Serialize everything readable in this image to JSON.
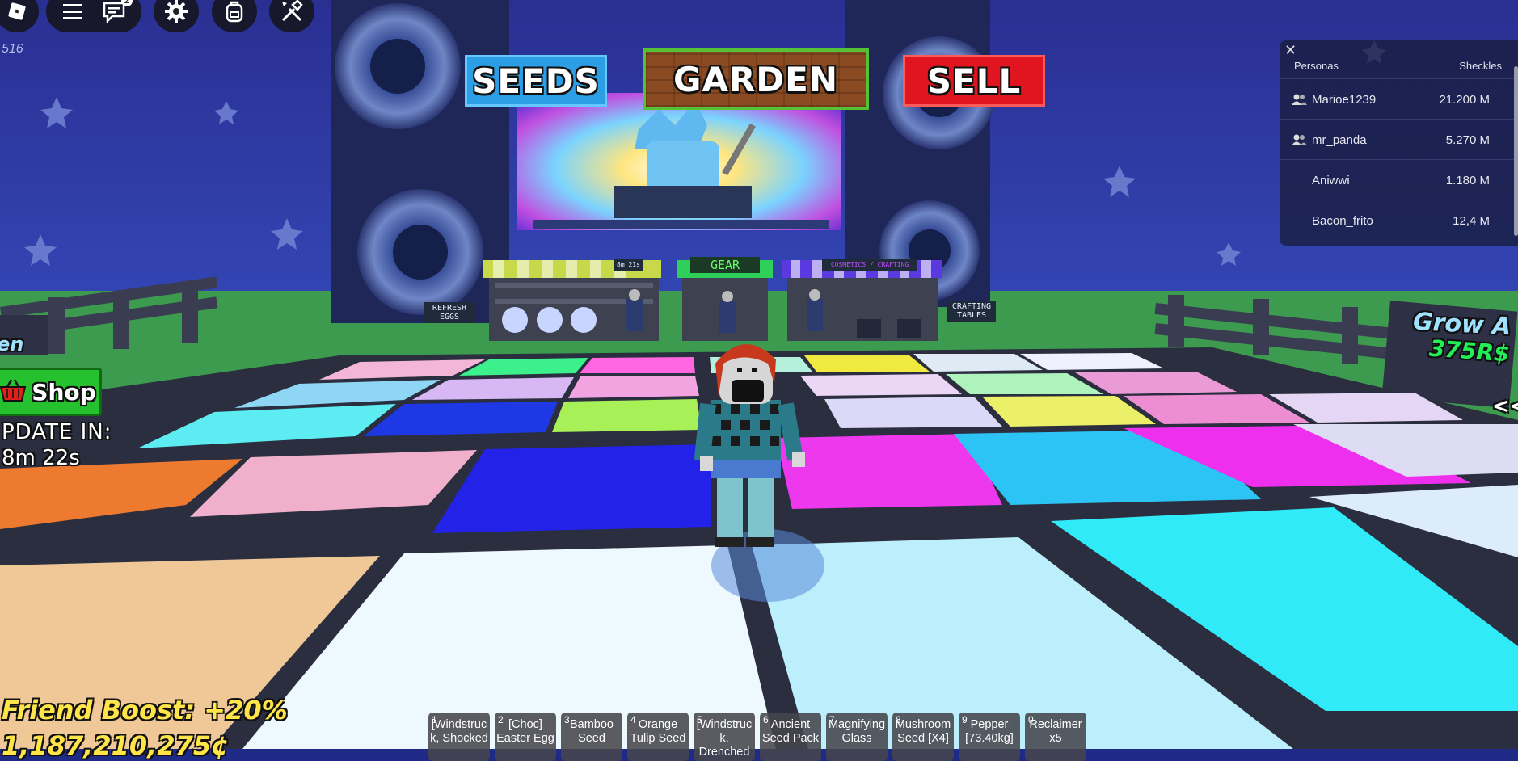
{
  "toolbar": {
    "buttons": [
      {
        "name": "roblox-menu-icon"
      },
      {
        "name": "hamburger-menu-icon"
      },
      {
        "name": "chat-icon",
        "badge": "2"
      },
      {
        "name": "settings-gear-icon"
      },
      {
        "name": "backpack-icon"
      },
      {
        "name": "build-tools-icon"
      }
    ],
    "fps_counter": "516"
  },
  "world_signs": {
    "seeds": "SEEDS",
    "garden": "GARDEN",
    "sell": "SELL",
    "gear": "GEAR",
    "cosmetics": "COSMETICS / CRAFTING",
    "refresh_eggs": "REFRESH EGGS",
    "crafting_tables": "CRAFTING TABLES",
    "stall_timer": "8m 21s",
    "grow_a": "Grow A",
    "grow_price": "375R$",
    "left_sign_fragment": "en"
  },
  "leaderboard": {
    "header_players": "Personas",
    "header_value": "Sheckles",
    "rows": [
      {
        "name": "Marioe1239",
        "value": "21.200 M",
        "friend_icon": true
      },
      {
        "name": "mr_panda",
        "value": "5.270 M",
        "friend_icon": true
      },
      {
        "name": "Aniwwi",
        "value": "1.180 M",
        "friend_icon": false
      },
      {
        "name": "Bacon_frito",
        "value": "12,4 M",
        "friend_icon": false
      }
    ]
  },
  "hud": {
    "shop_label": "Shop",
    "update_label": "PDATE IN:",
    "update_time": "8m 22s",
    "friend_boost": "Friend Boost: +20%",
    "money": "1,187,210,275¢",
    "side_arrow": "<<"
  },
  "hotbar": [
    {
      "key": "1",
      "label": "[Windstruck, Shocked"
    },
    {
      "key": "2",
      "label": "[Choc] Easter Egg"
    },
    {
      "key": "3",
      "label": "Bamboo Seed"
    },
    {
      "key": "4",
      "label": "Orange Tulip Seed"
    },
    {
      "key": "5",
      "label": "[Windstruck, Drenched"
    },
    {
      "key": "6",
      "label": "Ancient Seed Pack"
    },
    {
      "key": "7",
      "label": "Magnifying Glass"
    },
    {
      "key": "8",
      "label": "Mushroom Seed [X4]"
    },
    {
      "key": "9",
      "label": "Pepper [73.40kg]"
    },
    {
      "key": "0",
      "label": "Reclaimer x5"
    }
  ],
  "colors": {
    "sky": "#1e2a86",
    "grass": "#3c9b4e",
    "floor_lines": "#2a2e3e",
    "shop_green": "#26c12e",
    "money_yellow": "#ffe44a"
  }
}
